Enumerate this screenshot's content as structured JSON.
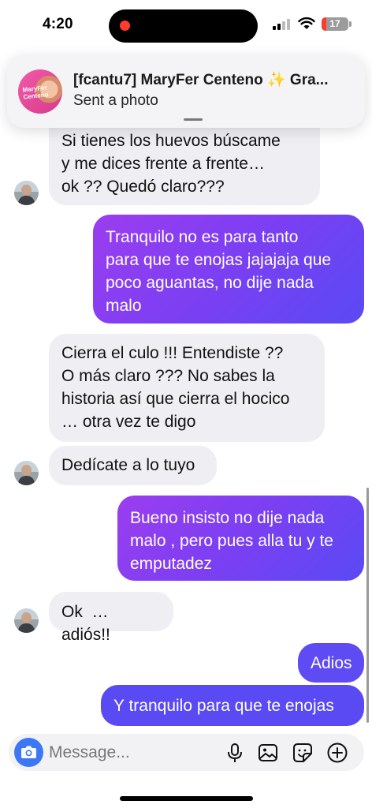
{
  "status_bar": {
    "time": "4:20",
    "battery": "17",
    "battery_level": 0.17
  },
  "notification": {
    "avatar_text": "MaryFer Centeno",
    "title": "[fcantu7] MaryFer Centeno ✨ Gra...",
    "subtitle": "Sent a photo"
  },
  "messages": [
    {
      "direction": "in",
      "text": "Si tienes los huevos búscame\ny me dices frente a frente…\nok ?? Quedó claro???"
    },
    {
      "direction": "out",
      "text": "Tranquilo no es para tanto\npara que te enojas jajajaja que\npoco aguantas, no dije nada\nmalo"
    },
    {
      "direction": "in",
      "text": "Cierra el culo !!! Entendiste ??\nO más claro ??? No sabes la\nhistoria así que cierra el hocico\n… otra vez te digo"
    },
    {
      "direction": "in",
      "text": "Dedícate a lo tuyo"
    },
    {
      "direction": "out",
      "text": "Bueno insisto no dije nada\nmalo , pero pues alla tu y te\nemputadez"
    },
    {
      "direction": "in",
      "text": "Ok  … adiós!!"
    },
    {
      "direction": "out",
      "text": "Adios"
    },
    {
      "direction": "out",
      "text": "Y tranquilo para que te enojas"
    }
  ],
  "composer": {
    "placeholder": "Message..."
  },
  "icons": {
    "camera": "camera-icon",
    "mic": "microphone-icon",
    "gallery": "gallery-icon",
    "sticker": "sticker-icon",
    "more": "plus-circle-icon"
  },
  "colors": {
    "outgoing_start": "#9b3df0",
    "outgoing_end": "#5a4af4",
    "incoming": "#efeff3",
    "camera_button": "#3c78f5"
  }
}
